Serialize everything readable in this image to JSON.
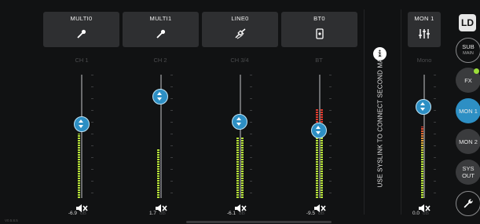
{
  "sources": [
    {
      "label": "MULTI0",
      "icon": "microphone-icon"
    },
    {
      "label": "MULTI1",
      "icon": "microphone-icon"
    },
    {
      "label": "LINE0",
      "icon": "cable-icon"
    },
    {
      "label": "BT0",
      "icon": "phone-icon"
    }
  ],
  "channels": [
    {
      "name": "CH 1",
      "value": "-6.9",
      "unit": "dB",
      "fader_level": 0.6,
      "meter_level": 0.52
    },
    {
      "name": "CH 2",
      "value": "1.7",
      "unit": "dB",
      "fader_level": 0.82,
      "meter_level": 0.4
    },
    {
      "name": "CH 3/4",
      "value": "-6.1",
      "unit": "dB",
      "fader_level": 0.62,
      "meter_level": 0.5
    },
    {
      "name": "BT",
      "value": "-9.5",
      "unit": "dB",
      "fader_level": 0.55,
      "meter_level": 0.72
    }
  ],
  "syslink_message": "USE SYSLINK TO CONNECT SECOND MAUI",
  "mon_strip": {
    "label": "MON 1",
    "name": "Mono",
    "value": "0.0",
    "unit": "dB",
    "fader_level": 0.74,
    "meter_level": 0.58
  },
  "sidebar": {
    "logo": "LD",
    "sub_label": "SUB",
    "sub_sub": "MAIN",
    "fx": "FX",
    "mon1": "MON 1",
    "mon2": "MON 2",
    "sys_out_1": "SYS",
    "sys_out_2": "OUT"
  },
  "version": "V0.5.8.5",
  "colors": {
    "accent": "#2d8fc4",
    "meter": "#b7e43a",
    "clip": "#e03a2e",
    "fx_dot": "#9bde3a"
  }
}
